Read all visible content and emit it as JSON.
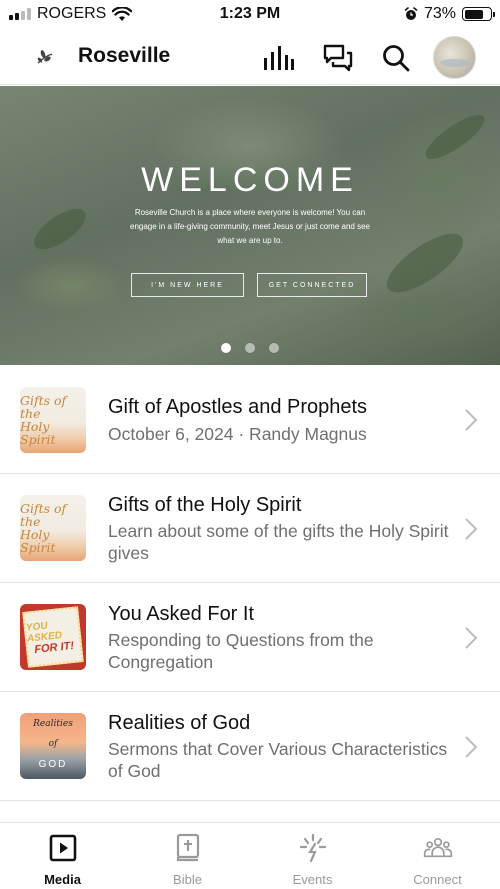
{
  "status_bar": {
    "carrier": "ROGERS",
    "time": "1:23 PM",
    "battery_percent": "73%",
    "battery_level": 0.73,
    "icons": [
      "signal-icon",
      "wifi-icon",
      "alarm-icon",
      "battery-icon"
    ]
  },
  "header": {
    "title": "Roseville",
    "icons": [
      "church-logo-icon",
      "audio-bars-icon",
      "chat-icon",
      "search-icon",
      "avatar"
    ]
  },
  "hero": {
    "title": "WELCOME",
    "subtitle": "Roseville Church is a place where everyone is welcome! You can engage in a life-giving community, meet Jesus or just come and see what we are up to.",
    "buttons": [
      "I'M NEW HERE",
      "GET CONNECTED"
    ],
    "carousel_count": 3,
    "carousel_active": 1
  },
  "list": [
    {
      "title": "Gift of Apostles and Prophets",
      "subtitle": "October 6, 2024 · Randy Magnus",
      "thumb_text": [
        "Gifts of the",
        "Holy Spirit"
      ]
    },
    {
      "title": "Gifts of the Holy Spirit",
      "subtitle": "Learn about some of the gifts the Holy Spirit gives",
      "thumb_text": [
        "Gifts of the",
        "Holy Spirit"
      ]
    },
    {
      "title": "You Asked For It",
      "subtitle": "Responding to Questions from the Congregation",
      "thumb_text": [
        "YOU ASKED",
        "FOR IT!"
      ]
    },
    {
      "title": "Realities of God",
      "subtitle": "Sermons that Cover Various Characteristics of God",
      "thumb_text": [
        "Realities",
        "of",
        "GOD"
      ]
    }
  ],
  "tabs": [
    {
      "label": "Media",
      "icon": "play-square-icon",
      "active": true
    },
    {
      "label": "Bible",
      "icon": "bible-icon",
      "active": false
    },
    {
      "label": "Events",
      "icon": "events-star-icon",
      "active": false
    },
    {
      "label": "Connect",
      "icon": "people-icon",
      "active": false
    }
  ],
  "colors": {
    "accent": "#111111",
    "muted": "#6f6f6f",
    "inactive_tab": "#9a9a9a",
    "divider": "#e3e3e3"
  }
}
